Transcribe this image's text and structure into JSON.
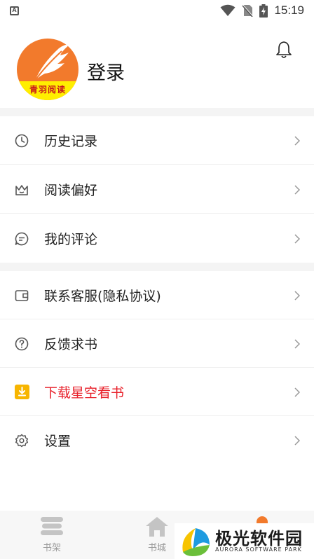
{
  "status_bar": {
    "notification_letter": "A",
    "time": "15:19"
  },
  "profile": {
    "avatar_text": "青羽阅读",
    "login_label": "登录"
  },
  "menu_group_1": [
    {
      "label": "历史记录",
      "icon": "clock-icon"
    },
    {
      "label": "阅读偏好",
      "icon": "crown-icon"
    },
    {
      "label": "我的评论",
      "icon": "comment-icon"
    }
  ],
  "menu_group_2": [
    {
      "label": "联系客服(隐私协议)",
      "icon": "wallet-icon"
    },
    {
      "label": "反馈求书",
      "icon": "question-icon"
    },
    {
      "label": "下载星空看书",
      "icon": "download-icon",
      "color": "#e8202a"
    },
    {
      "label": "设置",
      "icon": "gear-icon"
    }
  ],
  "tabbar": {
    "tabs": [
      {
        "label": "书架",
        "icon": "bookshelf-icon"
      },
      {
        "label": "书城",
        "icon": "home-icon"
      }
    ]
  },
  "watermark": {
    "title": "极光软件园",
    "subtitle": "AURORA SOFTWARE PARK"
  },
  "colors": {
    "accent": "#f27a2c",
    "highlight": "#e8202a",
    "download_icon_bg": "#f7b500",
    "section_gap": "#f4f4f4"
  }
}
